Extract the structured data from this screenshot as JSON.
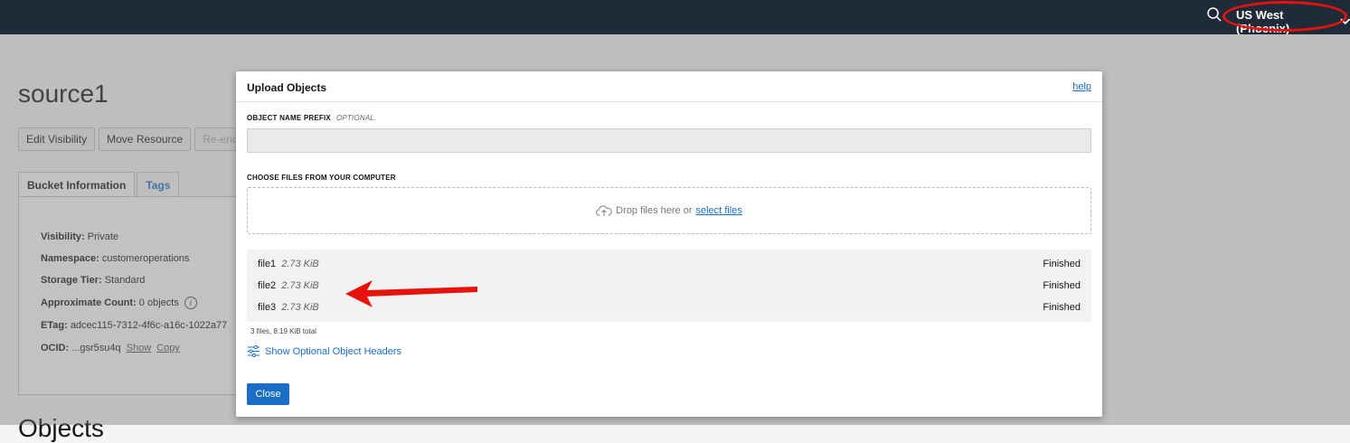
{
  "topbar": {
    "region": "US West (Phoenix)"
  },
  "bucket": {
    "title": "source1",
    "buttons": [
      "Edit Visibility",
      "Move Resource",
      "Re-encry"
    ],
    "tabs": [
      "Bucket Information",
      "Tags"
    ],
    "info": {
      "visibility_label": "Visibility:",
      "visibility_value": "Private",
      "namespace_label": "Namespace:",
      "namespace_value": "customeroperations",
      "tier_label": "Storage Tier:",
      "tier_value": "Standard",
      "count_label": "Approximate Count:",
      "count_value": "0 objects",
      "etag_label": "ETag:",
      "etag_value": "adcec115-7312-4f6c-a16c-1022a77",
      "ocid_label": "OCID:",
      "ocid_value": "...gsr5su4q",
      "show_link": "Show",
      "copy_link": "Copy"
    },
    "objects_heading": "Objects"
  },
  "modal": {
    "title": "Upload Objects",
    "help": "help",
    "prefix_label": "OBJECT NAME PREFIX",
    "prefix_optional": "OPTIONAL",
    "prefix_value": "",
    "choose_label": "CHOOSE FILES FROM YOUR COMPUTER",
    "drop_text": "Drop files here or",
    "select_files": "select files",
    "files": [
      {
        "name": "file1",
        "size": "2.73 KiB",
        "status": "Finished"
      },
      {
        "name": "file2",
        "size": "2.73 KiB",
        "status": "Finished"
      },
      {
        "name": "file3",
        "size": "2.73 KiB",
        "status": "Finished"
      }
    ],
    "summary": "3 files, 8.19 KiB total",
    "optional_headers": "Show Optional Object Headers",
    "close": "Close"
  },
  "colors": {
    "topbar": "#1f2b38",
    "accent": "#1a6ec8",
    "annotation": "#e8120c"
  }
}
